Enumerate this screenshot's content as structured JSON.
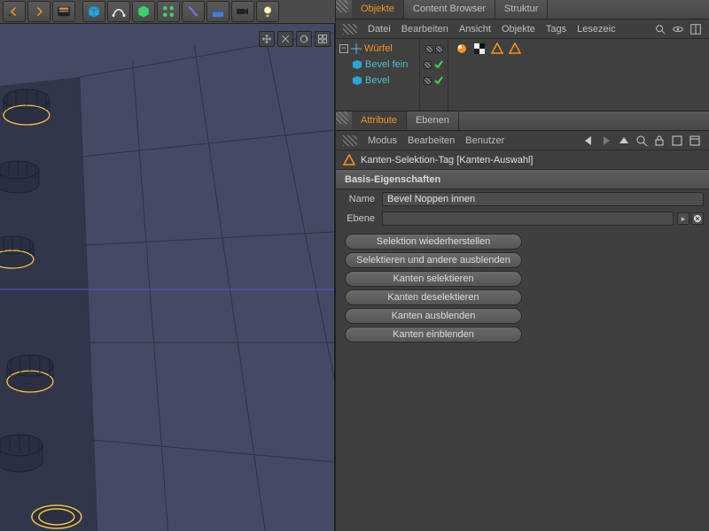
{
  "colors": {
    "accent": "#f7931e",
    "selection": "#f7c043",
    "green_check": "#4cd04c"
  },
  "object_manager": {
    "tabs": [
      "Objekte",
      "Content Browser",
      "Struktur"
    ],
    "active_tab_index": 0,
    "menu": [
      "Datei",
      "Bearbeiten",
      "Ansicht",
      "Objekte",
      "Tags",
      "Lesezeic"
    ],
    "tree": [
      {
        "label": "Würfel",
        "children": [
          {
            "label": "Bevel fein"
          },
          {
            "label": "Bevel"
          }
        ]
      }
    ],
    "row_tag_icons": [
      "phong-tag-icon",
      "texture-tag-icon",
      "edge-selection-tag-icon",
      "edge-selection-tag-icon"
    ]
  },
  "attribute_manager": {
    "tabs": [
      "Attribute",
      "Ebenen"
    ],
    "active_tab_index": 0,
    "menu": [
      "Modus",
      "Bearbeiten",
      "Benutzer"
    ],
    "header_label": "Kanten-Selektion-Tag [Kanten-Auswahl]",
    "section_label": "Basis-Eigenschaften",
    "fields": {
      "name_label": "Name",
      "name_value": "Bevel Noppen innen",
      "layer_label": "Ebene",
      "layer_value": ""
    },
    "action_buttons": [
      "Selektion wiederherstellen",
      "Selektieren und andere ausblenden",
      "Kanten selektieren",
      "Kanten deselektieren",
      "Kanten ausblenden",
      "Kanten einblenden"
    ]
  }
}
